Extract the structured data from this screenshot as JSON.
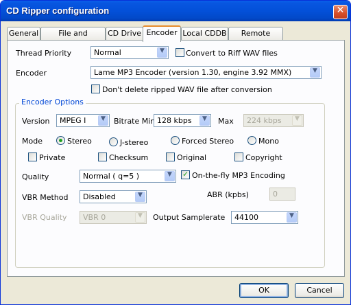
{
  "window": {
    "title": "CD Ripper configuration",
    "close_label": "✕"
  },
  "tabs": [
    {
      "label": "General"
    },
    {
      "label": "File and Directory"
    },
    {
      "label": "CD Drive"
    },
    {
      "label": "Encoder",
      "active": true
    },
    {
      "label": "Local CDDB"
    },
    {
      "label": "Remote CDDB"
    }
  ],
  "thread_priority": {
    "label": "Thread Priority",
    "value": "Normal"
  },
  "convert_riff": {
    "label": "Convert to Riff WAV files",
    "checked": false
  },
  "encoder": {
    "label": "Encoder",
    "value": "Lame MP3 Encoder (version 1.30, engine 3.92 MMX)"
  },
  "dont_delete": {
    "label": "Don't delete ripped WAV file after conversion",
    "checked": false
  },
  "encoder_options": {
    "group_title": "Encoder Options",
    "version": {
      "label": "Version",
      "value": "MPEG I"
    },
    "bitrate_min": {
      "label": "Bitrate Min",
      "value": "128 kbps"
    },
    "bitrate_max": {
      "label": "Max",
      "value": "224 kbps",
      "disabled": true
    },
    "mode": {
      "label": "Mode",
      "options": [
        {
          "label": "Stereo",
          "selected": true
        },
        {
          "label": "J-stereo",
          "selected": false
        },
        {
          "label": "Forced Stereo",
          "selected": false
        },
        {
          "label": "Mono",
          "selected": false
        }
      ]
    },
    "flags": [
      {
        "label": "Private",
        "checked": false
      },
      {
        "label": "Checksum",
        "checked": false
      },
      {
        "label": "Original",
        "checked": false
      },
      {
        "label": "Copyright",
        "checked": false
      }
    ],
    "quality": {
      "label": "Quality",
      "value": "Normal ( q=5 )"
    },
    "on_the_fly": {
      "label": "On-the-fly MP3 Encoding",
      "checked": true
    },
    "vbr_method": {
      "label": "VBR Method",
      "value": "Disabled"
    },
    "abr": {
      "label": "ABR (kpbs)",
      "value": "0",
      "disabled": true
    },
    "vbr_quality": {
      "label": "VBR Quality",
      "value": "VBR 0",
      "disabled": true
    },
    "output_samplerate": {
      "label": "Output Samplerate",
      "value": "44100"
    }
  },
  "buttons": {
    "ok": "OK",
    "cancel": "Cancel"
  },
  "icons": {
    "dropdown": "▼"
  },
  "colors": {
    "titlebar": "#0350d9",
    "group_title": "#0046d5",
    "active_tab_accent": "#e68b2c",
    "check": "#21a121"
  }
}
